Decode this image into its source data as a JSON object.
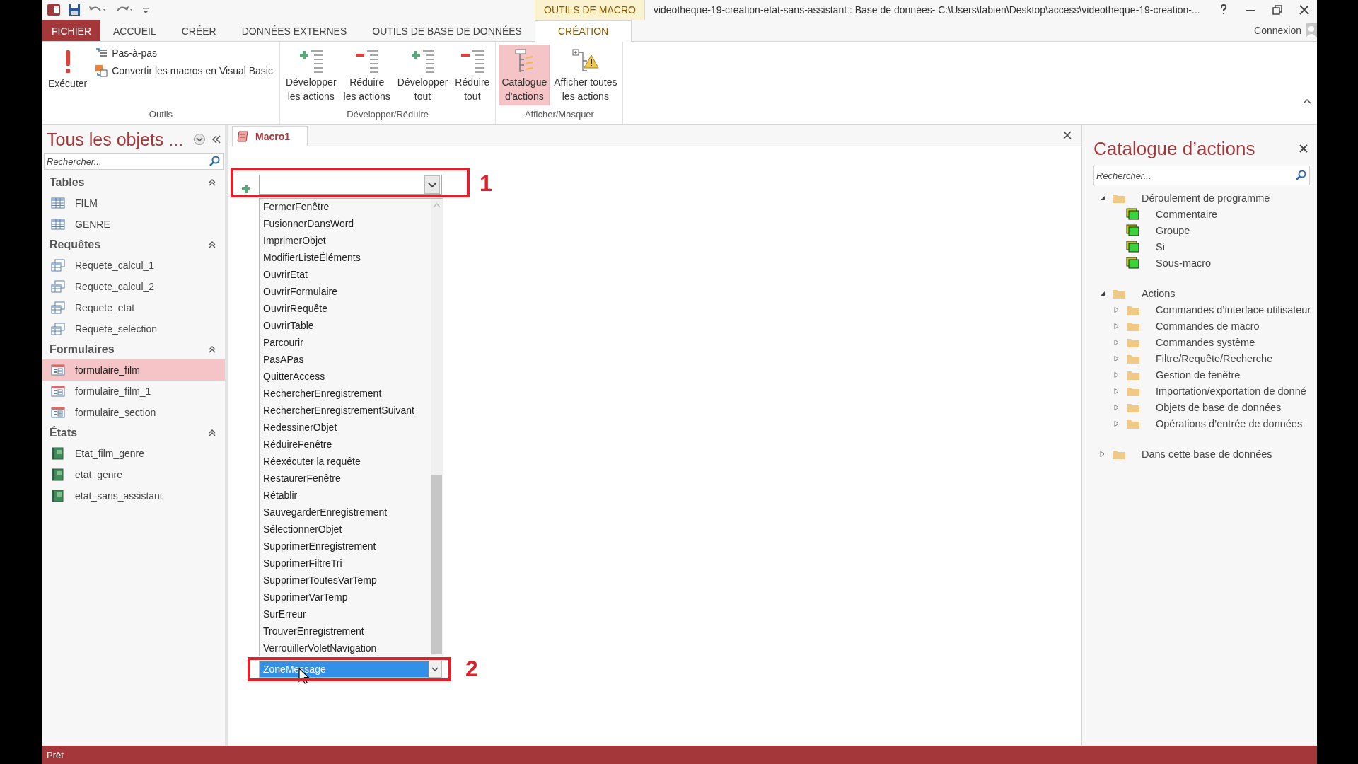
{
  "window": {
    "title": "videotheque-19-creation-etat-sans-assistant : Base de données- C:\\Users\\fabien\\Desktop\\access\\videotheque-19-creation-...",
    "context_tab": "OUTILS DE MACRO",
    "sign_in": "Connexion"
  },
  "ribbon_tabs": [
    {
      "label": "FICHIER",
      "kind": "file",
      "selected": false
    },
    {
      "label": "ACCUEIL",
      "kind": "tab",
      "selected": false
    },
    {
      "label": "CRÉER",
      "kind": "tab",
      "selected": false
    },
    {
      "label": "DONNÉES EXTERNES",
      "kind": "tab",
      "selected": false
    },
    {
      "label": "OUTILS DE BASE DE DONNÉES",
      "kind": "tab",
      "selected": false
    },
    {
      "label": "CRÉATION",
      "kind": "context",
      "selected": true
    }
  ],
  "ribbon_groups": [
    {
      "label": "Outils",
      "buttons": [
        {
          "label": "Exécuter",
          "kind": "large",
          "selected": false
        },
        {
          "label": "Pas-à-pas",
          "kind": "small",
          "selected": false
        },
        {
          "label": "Convertir les macros en Visual Basic",
          "kind": "small",
          "selected": false
        }
      ]
    },
    {
      "label": "Développer/Réduire",
      "buttons": [
        {
          "label": "Développer\nles actions",
          "kind": "large",
          "selected": false
        },
        {
          "label": "Réduire\nles actions",
          "kind": "large",
          "selected": false
        },
        {
          "label": "Développer\ntout",
          "kind": "large",
          "selected": false
        },
        {
          "label": "Réduire\ntout",
          "kind": "large",
          "selected": false
        }
      ]
    },
    {
      "label": "Afficher/Masquer",
      "buttons": [
        {
          "label": "Catalogue\nd'actions",
          "kind": "large",
          "selected": true
        },
        {
          "label": "Afficher toutes\nles actions",
          "kind": "large",
          "selected": false
        }
      ]
    }
  ],
  "navigation_pane": {
    "title": "Tous les objets ...",
    "search": {
      "placeholder": "Rechercher..."
    },
    "groups": [
      {
        "label": "Tables",
        "expanded": true,
        "items": [
          {
            "label": "FILM",
            "kind": "table",
            "selected": false
          },
          {
            "label": "GENRE",
            "kind": "table",
            "selected": false
          }
        ]
      },
      {
        "label": "Requêtes",
        "expanded": true,
        "items": [
          {
            "label": "Requete_calcul_1",
            "kind": "query",
            "selected": false
          },
          {
            "label": "Requete_calcul_2",
            "kind": "query",
            "selected": false
          },
          {
            "label": "Requete_etat",
            "kind": "query",
            "selected": false
          },
          {
            "label": "Requete_selection",
            "kind": "query",
            "selected": false
          }
        ]
      },
      {
        "label": "Formulaires",
        "expanded": true,
        "items": [
          {
            "label": "formulaire_film",
            "kind": "form",
            "selected": true
          },
          {
            "label": "formulaire_film_1",
            "kind": "form",
            "selected": false
          },
          {
            "label": "formulaire_section",
            "kind": "form",
            "selected": false
          }
        ]
      },
      {
        "label": "États",
        "expanded": true,
        "items": [
          {
            "label": "Etat_film_genre",
            "kind": "report",
            "selected": false
          },
          {
            "label": "etat_genre",
            "kind": "report",
            "selected": false
          },
          {
            "label": "etat_sans_assistant",
            "kind": "report",
            "selected": false
          }
        ]
      }
    ]
  },
  "document_tabs": [
    {
      "label": "Macro1",
      "selected": true
    }
  ],
  "macro_editor": {
    "action_list": {
      "options": [
        "FermerFenêtre",
        "FusionnerDansWord",
        "ImprimerObjet",
        "ModifierListeÉléments",
        "OuvrirEtat",
        "OuvrirFormulaire",
        "OuvrirRequête",
        "OuvrirTable",
        "Parcourir",
        "PasAPas",
        "QuitterAccess",
        "RechercherEnregistrement",
        "RechercherEnregistrementSuivant",
        "RedessinerObjet",
        "RéduireFenêtre",
        "Réexécuter la requête",
        "RestaurerFenêtre",
        "Rétablir",
        "SauvegarderEnregistrement",
        "SélectionnerObjet",
        "SupprimerEnregistrement",
        "SupprimerFiltreTri",
        "SupprimerToutesVarTemp",
        "SupprimerVarTemp",
        "SurErreur",
        "TrouverEnregistrement",
        "VerrouillerVoletNavigation"
      ],
      "value": "ZoneMessage"
    },
    "annotations": [
      {
        "label": "1"
      },
      {
        "label": "2"
      }
    ]
  },
  "action_catalog": {
    "title": "Catalogue d’actions",
    "search": {
      "placeholder": "Rechercher..."
    },
    "tree": [
      {
        "label": "Déroulement de programme",
        "kind": "folder",
        "expanded": true,
        "children": [
          {
            "label": "Commentaire",
            "kind": "action"
          },
          {
            "label": "Groupe",
            "kind": "action"
          },
          {
            "label": "Si",
            "kind": "action"
          },
          {
            "label": "Sous-macro",
            "kind": "action"
          }
        ]
      },
      {
        "label": "Actions",
        "kind": "folder",
        "expanded": true,
        "children": [
          {
            "label": "Commandes d’interface utilisateur",
            "kind": "folder",
            "expanded": false
          },
          {
            "label": "Commandes de macro",
            "kind": "folder",
            "expanded": false
          },
          {
            "label": "Commandes système",
            "kind": "folder",
            "expanded": false
          },
          {
            "label": "Filtre/Requête/Recherche",
            "kind": "folder",
            "expanded": false
          },
          {
            "label": "Gestion de fenêtre",
            "kind": "folder",
            "expanded": false
          },
          {
            "label": "Importation/exportation de donné",
            "kind": "folder",
            "expanded": false
          },
          {
            "label": "Objets de base de données",
            "kind": "folder",
            "expanded": false
          },
          {
            "label": "Opérations d’entrée de données",
            "kind": "folder",
            "expanded": false
          }
        ]
      },
      {
        "label": "Dans cette base de données",
        "kind": "folder",
        "expanded": false
      }
    ]
  },
  "status_bar": {
    "text": "Prêt"
  }
}
